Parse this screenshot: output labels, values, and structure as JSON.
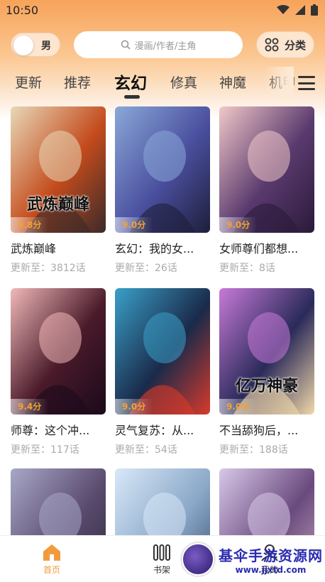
{
  "status_bar": {
    "time": "10:50"
  },
  "topbar": {
    "gender_label": "男",
    "search_placeholder": "漫画/作者/主角",
    "category_label": "分类"
  },
  "tabs": [
    {
      "label": "更新",
      "active": false
    },
    {
      "label": "推荐",
      "active": false
    },
    {
      "label": "玄幻",
      "active": true
    },
    {
      "label": "修真",
      "active": false
    },
    {
      "label": "神魔",
      "active": false
    },
    {
      "label": "机甲",
      "active": false
    }
  ],
  "comics": [
    {
      "title": "武炼巅峰",
      "update": "更新至：3812话",
      "score": "9.8分",
      "cover_title": "武炼巅峰",
      "colors": [
        "#e8d8b8",
        "#c44b1c",
        "#3a2a2a"
      ]
    },
    {
      "title": "玄幻：我的女...",
      "update": "更新至：26话",
      "score": "9.0分",
      "colors": [
        "#8aa8d8",
        "#4a4f9e",
        "#1e1e3a"
      ]
    },
    {
      "title": "女师尊们都想...",
      "update": "更新至：8话",
      "score": "9.0分",
      "colors": [
        "#f1c8c8",
        "#5a3a6e",
        "#2a1a3a"
      ]
    },
    {
      "title": "师尊：这个冲...",
      "update": "更新至：117话",
      "score": "9.4分",
      "colors": [
        "#f0b8b8",
        "#4a1a2a",
        "#1a0a1a"
      ]
    },
    {
      "title": "灵气复苏：从...",
      "update": "更新至：54话",
      "score": "9.0分",
      "colors": [
        "#3aa0c8",
        "#1a2a4a",
        "#d83a2a"
      ]
    },
    {
      "title": "不当舔狗后，...",
      "update": "更新至：188话",
      "score": "9.0分",
      "cover_title": "亿万神豪",
      "colors": [
        "#c87ad8",
        "#2a2a5a",
        "#f2d8a8"
      ]
    },
    {
      "title": "",
      "update": "",
      "score": "",
      "colors": [
        "#a8a8c8",
        "#5a4a6e",
        "#2a2a3a"
      ]
    },
    {
      "title": "",
      "update": "",
      "score": "",
      "colors": [
        "#d8e8f8",
        "#8aa8c8",
        "#3a4a6a"
      ]
    },
    {
      "title": "",
      "update": "",
      "score": "",
      "colors": [
        "#d8c8e8",
        "#6a4a7e",
        "#c8a8b8"
      ]
    }
  ],
  "bottom_nav": [
    {
      "label": "首页",
      "active": true
    },
    {
      "label": "书架",
      "active": false
    },
    {
      "label": "我的",
      "active": false
    }
  ],
  "watermark": {
    "title": "基伞手游资源网",
    "url": "www.jjxtd.com"
  },
  "colors": {
    "accent": "#f29b3b",
    "header_top": "#f7a35a"
  }
}
